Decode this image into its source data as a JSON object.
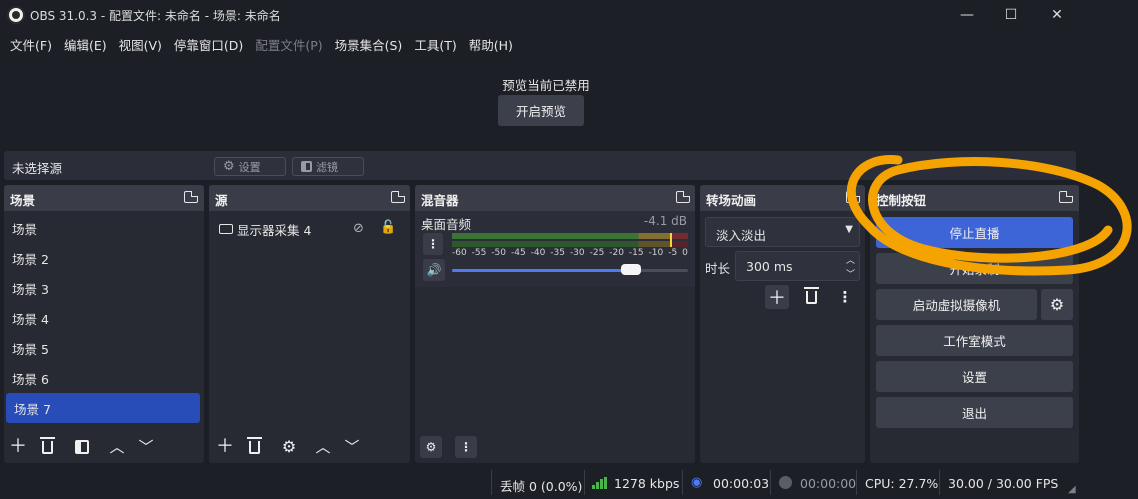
{
  "window": {
    "title": "OBS 31.0.3 - 配置文件: 未命名 - 场景: 未命名",
    "minimize": "—",
    "maximize": "☐",
    "close": "✕"
  },
  "menu": [
    "文件(F)",
    "编辑(E)",
    "视图(V)",
    "停靠窗口(D)",
    "配置文件(P)",
    "场景集合(S)",
    "工具(T)",
    "帮助(H)"
  ],
  "preview": {
    "disabled_msg": "预览当前已禁用",
    "enable_button": "开启预览"
  },
  "source_bar": {
    "no_source": "未选择源",
    "properties": "设置",
    "filters": "滤镜"
  },
  "scenes": {
    "title": "场景",
    "items": [
      "场景",
      "场景 2",
      "场景 3",
      "场景 4",
      "场景 5",
      "场景 6",
      "场景 7"
    ],
    "selected_index": 6
  },
  "sources": {
    "title": "源",
    "items": [
      {
        "name": "显示器采集 4"
      }
    ]
  },
  "mixer": {
    "title": "混音器",
    "channel": "桌面音频",
    "level": "-4.1 dB",
    "scale": [
      "-60",
      "-55",
      "-50",
      "-45",
      "-40",
      "-35",
      "-30",
      "-25",
      "-20",
      "-15",
      "-10",
      "-5",
      "0"
    ],
    "volume": 0.76
  },
  "transitions": {
    "title": "转场动画",
    "selected": "淡入淡出",
    "duration_label": "时长",
    "duration": "300 ms"
  },
  "controls": {
    "title": "控制按钮",
    "buttons": [
      "停止直播",
      "开始录制",
      "启动虚拟摄像机",
      "工作室模式",
      "设置",
      "退出"
    ]
  },
  "status": {
    "dropped": "丢帧 0 (0.0%)",
    "bitrate": "1278 kbps",
    "stream_time": "00:00:03",
    "record_time": "00:00:00",
    "cpu": "CPU: 27.7%",
    "fps": "30.00 / 30.00 FPS"
  },
  "colors": {
    "accent": "#3d65d8",
    "selected": "#284cb8",
    "annotation": "#f5a300",
    "background": "#1d1f26"
  }
}
